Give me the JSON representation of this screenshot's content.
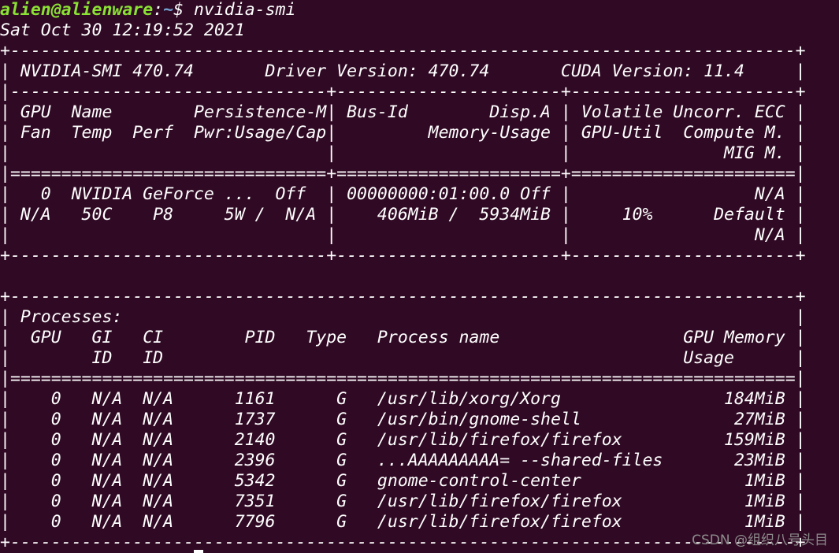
{
  "terminal": {
    "prompt": {
      "user_host": "alien@alienware",
      "separator": ":",
      "path": "~",
      "symbol": "$ ",
      "command": "nvidia-smi"
    },
    "output_lines": [
      "Sat Oct 30 12:19:52 2021",
      "+-----------------------------------------------------------------------------+",
      "| NVIDIA-SMI 470.74       Driver Version: 470.74       CUDA Version: 11.4     |",
      "|-------------------------------+----------------------+----------------------+",
      "| GPU  Name        Persistence-M| Bus-Id        Disp.A | Volatile Uncorr. ECC |",
      "| Fan  Temp  Perf  Pwr:Usage/Cap|         Memory-Usage | GPU-Util  Compute M. |",
      "|                               |                      |               MIG M. |",
      "|===============================+======================+======================|",
      "|   0  NVIDIA GeForce ...  Off  | 00000000:01:00.0 Off |                  N/A |",
      "| N/A   50C    P8     5W /  N/A |    406MiB /  5934MiB |     10%      Default |",
      "|                               |                      |                  N/A |",
      "+-------------------------------+----------------------+----------------------+",
      "",
      "+-----------------------------------------------------------------------------+",
      "| Processes:                                                                  |",
      "|  GPU   GI   CI        PID   Type   Process name                  GPU Memory |",
      "|        ID   ID                                                   Usage      |",
      "|=============================================================================|",
      "|    0   N/A  N/A      1161      G   /usr/lib/xorg/Xorg                184MiB |",
      "|    0   N/A  N/A      1737      G   /usr/bin/gnome-shell               27MiB |",
      "|    0   N/A  N/A      2140      G   /usr/lib/firefox/firefox          159MiB |",
      "|    0   N/A  N/A      2396      G   ...AAAAAAAAA= --shared-files       23MiB |",
      "|    0   N/A  N/A      5342      G   gnome-control-center                1MiB |",
      "|    0   N/A  N/A      7351      G   /usr/lib/firefox/firefox            1MiB |",
      "|    0   N/A  N/A      7796      G   /usr/lib/firefox/firefox            1MiB |",
      "+-----------------------------------------------------------------------------+"
    ]
  },
  "watermark": "CSDN @组织八号头目",
  "colors": {
    "background": "#300a24",
    "text": "#ffffff",
    "prompt_user": "#8ae234",
    "prompt_path": "#729fcf"
  }
}
